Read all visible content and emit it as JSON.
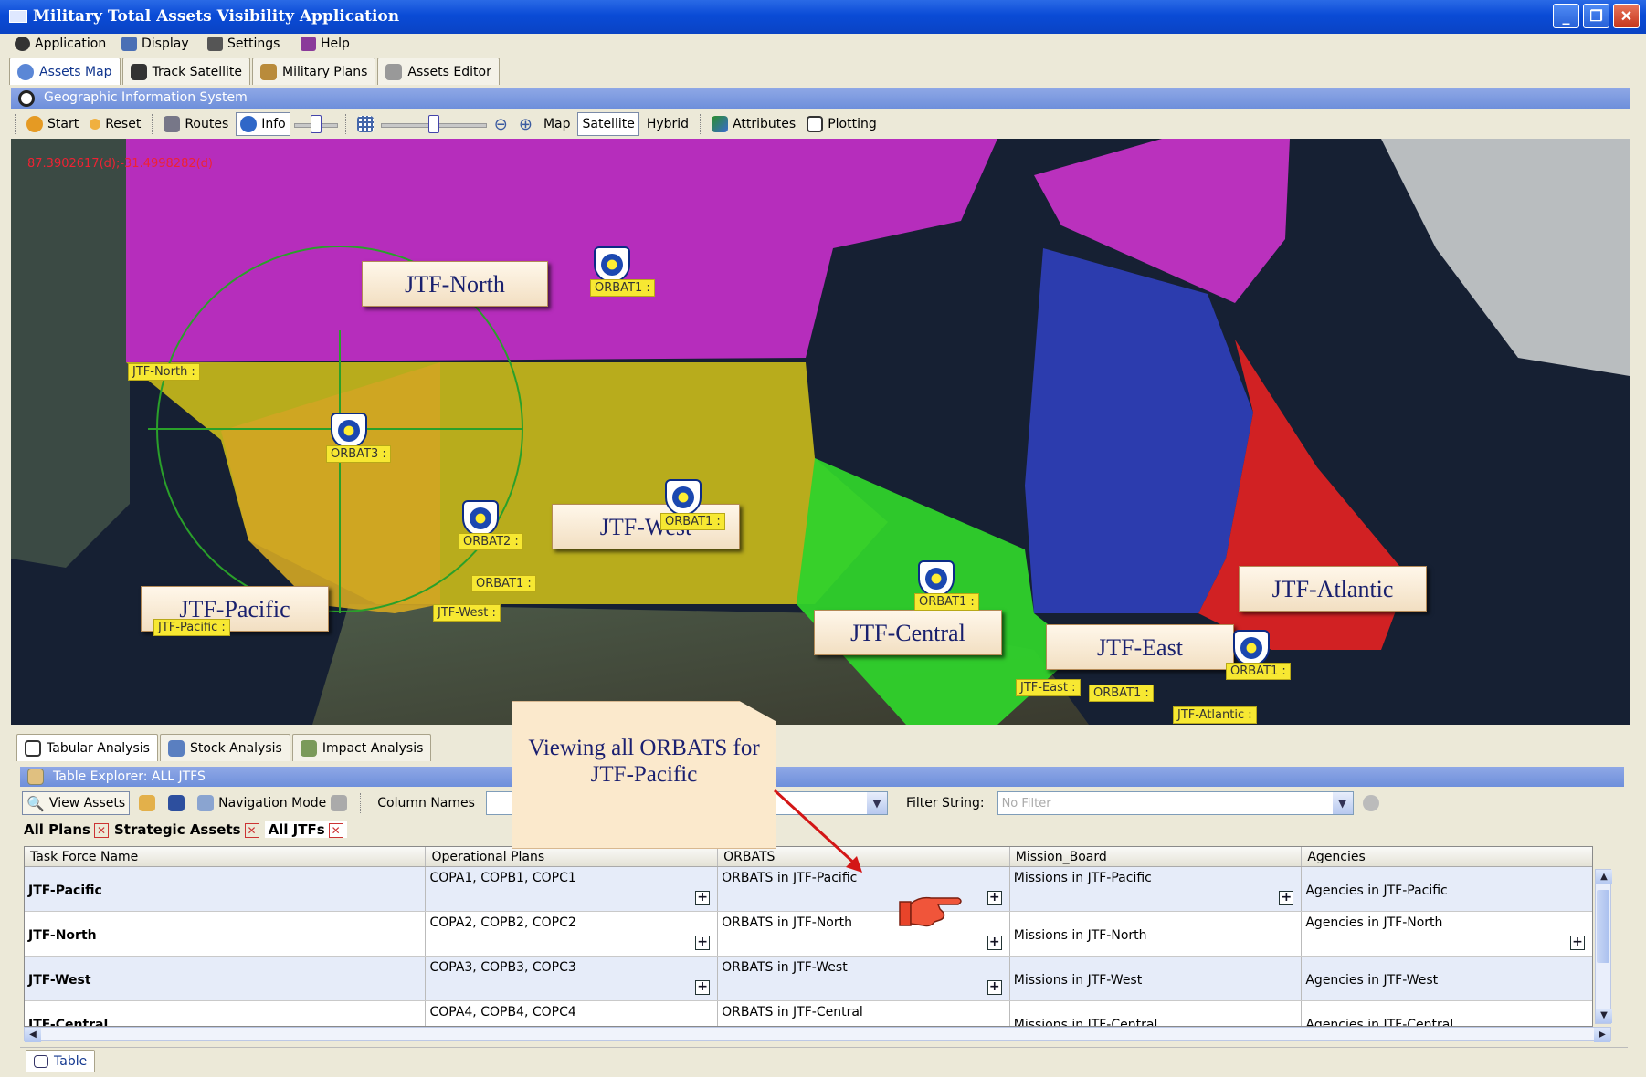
{
  "window": {
    "title": "Military Total Assets Visibility Application"
  },
  "menu": [
    "Application",
    "Display",
    "Settings",
    "Help"
  ],
  "main_tabs": [
    "Assets Map",
    "Track Satellite",
    "Military Plans",
    "Assets Editor"
  ],
  "gis": {
    "header": "Geographic Information System",
    "toolbar": {
      "start": "Start",
      "reset": "Reset",
      "routes": "Routes",
      "info": "Info",
      "map": "Map",
      "satellite": "Satellite",
      "hybrid": "Hybrid",
      "attributes": "Attributes",
      "plotting": "Plotting"
    },
    "coordinate": "87.3902617(d);-31.4998282(d)",
    "regions": [
      {
        "label": "JTF-North",
        "tag": "JTF-North :"
      },
      {
        "label": "JTF-Pacific",
        "tag": "JTF-Pacific :"
      },
      {
        "label": "JTF-West",
        "tag": "JTF-West :"
      },
      {
        "label": "JTF-Central",
        "tag": ""
      },
      {
        "label": "JTF-East",
        "tag": "JTF-East :"
      },
      {
        "label": "JTF-Atlantic",
        "tag": "JTF-Atlantic :"
      }
    ],
    "orbat_tags": [
      "ORBAT1 :",
      "ORBAT3 :",
      "ORBAT2 :",
      "ORBAT1 :",
      "ORBAT1 :",
      "ORBAT1 :",
      "ORBAT1 :",
      "ORBAT1 :"
    ]
  },
  "bottom_tabs": [
    "Tabular Analysis",
    "Stock Analysis",
    "Impact Analysis"
  ],
  "table_explorer": {
    "header": "Table Explorer: ALL JTFS",
    "view_assets": "View Assets",
    "navigation_mode": "Navigation Mode",
    "column_names": "Column Names",
    "filter_label": "Filter String:",
    "filter_placeholder": "No Filter",
    "filter_tabs": [
      "All Plans",
      "Strategic Assets",
      "All JTFs"
    ],
    "columns": [
      "Task Force Name",
      "Operational Plans",
      "ORBATS",
      "Mission_Board",
      "Agencies"
    ],
    "rows": [
      [
        "JTF-Pacific",
        "COPA1, COPB1, COPC1",
        "ORBATS in JTF-Pacific",
        "Missions in JTF-Pacific",
        "Agencies in JTF-Pacific"
      ],
      [
        "JTF-North",
        "COPA2, COPB2, COPC2",
        "ORBATS in JTF-North",
        "Missions in JTF-North",
        "Agencies in JTF-North"
      ],
      [
        "JTF-West",
        "COPA3, COPB3, COPC3",
        "ORBATS in JTF-West",
        "Missions in JTF-West",
        "Agencies in JTF-West"
      ],
      [
        "JTF-Central",
        "COPA4, COPB4, COPC4",
        "ORBATS in JTF-Central",
        "Missions in JTF-Central",
        "Agencies in JTF-Central"
      ]
    ]
  },
  "callout": "Viewing all ORBATS for JTF-Pacific",
  "status_tab": "Table"
}
